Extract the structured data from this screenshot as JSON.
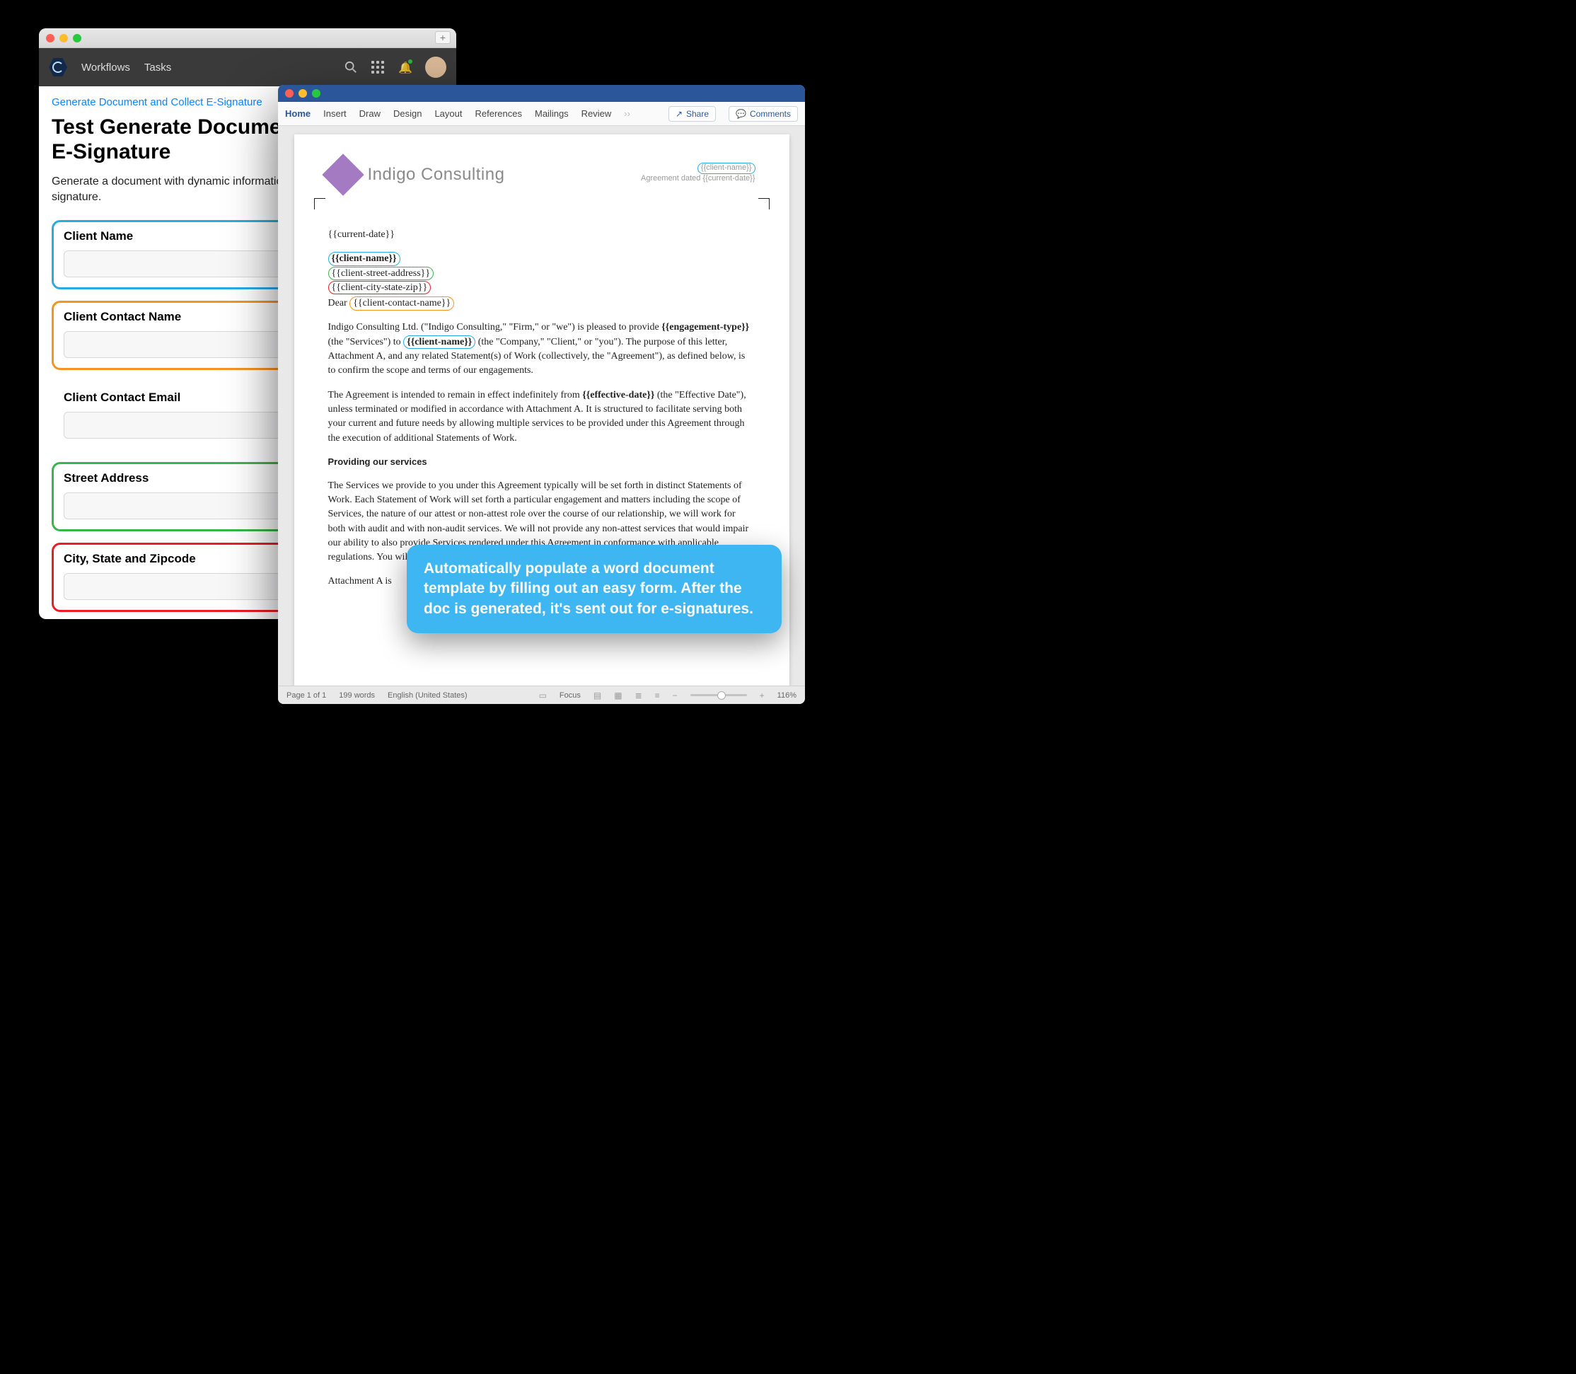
{
  "form": {
    "nav": {
      "workflows": "Workflows",
      "tasks": "Tasks"
    },
    "breadcrumb": "Generate Document and Collect E-Signature",
    "title": "Test Generate Document and Collect E-Signature",
    "description": "Generate a document with dynamic information, then send it out for electronic signature.",
    "fields": {
      "client_name": {
        "label": "Client Name"
      },
      "client_contact_name": {
        "label": "Client Contact Name"
      },
      "client_contact_email": {
        "label": "Client Contact Email"
      },
      "street_address": {
        "label": "Street Address"
      },
      "city_state_zip": {
        "label": "City, State and Zipcode"
      }
    }
  },
  "word": {
    "ribbon": {
      "tabs": {
        "home": "Home",
        "insert": "Insert",
        "draw": "Draw",
        "design": "Design",
        "layout": "Layout",
        "references": "References",
        "mailings": "Mailings",
        "review": "Review"
      },
      "share": "Share",
      "comments": "Comments"
    },
    "header": {
      "company": "Indigo Consulting",
      "right_token": "{{client-name}}",
      "right_line_prefix": "Agreement dated ",
      "right_line_token": "{{current-date}}"
    },
    "tokens": {
      "current_date": "{{current-date}}",
      "client_name": "{{client-name}}",
      "client_street": "{{client-street-address}}",
      "client_csz": "{{client-city-state-zip}}",
      "client_contact": "{{client-contact-name}}",
      "engagement_type": "{{engagement-type}}",
      "effective_date": "{{effective-date}}"
    },
    "body": {
      "dear_prefix": "Dear ",
      "p1a": "Indigo Consulting Ltd. (\"Indigo Consulting,\" \"Firm,\" or \"we\") is pleased to provide ",
      "p1b": " (the \"Services\") to ",
      "p1c": " (the \"Company,\" \"Client,\" or \"you\"). The purpose of this letter, Attachment A, and any related Statement(s) of Work (collectively, the \"Agreement\"), as defined below, is to confirm the scope and terms of our engagements.",
      "p2a": "The Agreement is intended to remain in effect indefinitely from ",
      "p2b": " (the \"Effective Date\"), unless terminated or modified in accordance with Attachment A.  It is structured to facilitate serving both your current and future needs by allowing multiple services to be provided under this Agreement through the execution of additional Statements of Work.",
      "sec": "Providing our services",
      "p3": "The Services we provide to you under this Agreement typically will be set forth in distinct Statements of Work. Each Statement of Work will set forth a particular engagement and matters including the scope of Services, the nature of our attest or non-attest role over the course of our relationship, we will work for both with audit and with non-audit services. We will not provide any non-attest services that would impair our ability to also provide Services rendered under this Agreement in conformance with applicable regulations. You will be billed at our standard hourly rates.",
      "p4": "Attachment A is"
    },
    "status": {
      "page": "Page 1 of 1",
      "words": "199 words",
      "lang": "English (United States)",
      "focus": "Focus",
      "zoom": "116%"
    }
  },
  "callout": "Automatically populate a word document template by filling out an easy form. After the doc is generated, it's sent out for e-signatures."
}
